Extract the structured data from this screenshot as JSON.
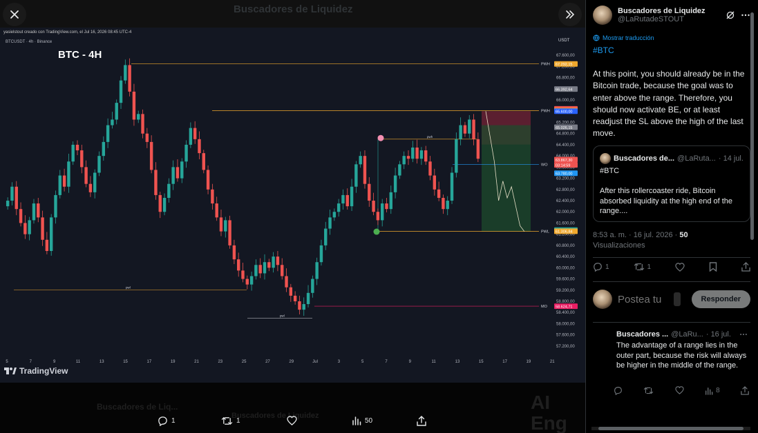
{
  "viewer": {
    "close_icon": "close-icon",
    "expand_icon": "chevrons-right-icon",
    "bg_title": "Buscadores de Liquidez",
    "tv_header": "yasielstout creado con TradingView.com, el Jul 16, 2026 08:45 UTC-4",
    "tv_brand": "TradingView",
    "actions": {
      "replies": "1",
      "retweets": "1",
      "views": "50"
    },
    "bg_bottom_name": "Buscadores de Liq...",
    "bg_bottom_name2": "Buscadores de Liquidez",
    "bg_promo": "AI Eng Tutor"
  },
  "chart_data": {
    "type": "candlestick",
    "symbol": "BTCUSDT · 4h · Binance",
    "title": "BTC - 4H",
    "currency": "USDT",
    "x_tick_labels": [
      "5",
      "7",
      "9",
      "11",
      "13",
      "15",
      "17",
      "19",
      "21",
      "23",
      "25",
      "27",
      "29",
      "Jul",
      "3",
      "5",
      "7",
      "9",
      "11",
      "13",
      "15",
      "17",
      "19",
      "21"
    ],
    "y_ticks": [
      67600,
      67200,
      66800,
      66400,
      66000,
      65600,
      65200,
      64800,
      64400,
      64000,
      63600,
      63200,
      62800,
      62400,
      62000,
      61600,
      61200,
      60800,
      60400,
      60000,
      59600,
      59200,
      58800,
      58400,
      58000,
      57600,
      57200
    ],
    "y_tick_labels": [
      "67.600,00",
      "67.200,00",
      "66.800,00",
      "66.400,00",
      "66.000,00",
      "65.600,00",
      "65.200,00",
      "64.800,00",
      "64.400,00",
      "64.000,00",
      "63.600,00",
      "63.200,00",
      "62.800,00",
      "62.400,00",
      "62.000,00",
      "61.600,00",
      "61.200,00",
      "60.800,00",
      "60.400,00",
      "60.000,00",
      "59.600,00",
      "59.200,00",
      "58.800,00",
      "58.400,00",
      "58.000,00",
      "57.600,00",
      "57.200,00"
    ],
    "ylim": [
      56900,
      68000
    ],
    "price_tags": [
      {
        "value": 67292.15,
        "label": "67.292,15",
        "color": "#f0a82d"
      },
      {
        "value": 66392.64,
        "label": "66.392,64",
        "color": "#787b86"
      },
      {
        "value": 65684.32,
        "label": "65.684,32",
        "color": "#ef5350"
      },
      {
        "value": 65622.83,
        "label": "65.622,83",
        "color": "#f0a82d"
      },
      {
        "value": 65600.0,
        "label": "65.600,00",
        "color": "#2962ff"
      },
      {
        "value": 65026.15,
        "label": "65.026,15",
        "color": "#787b86"
      },
      {
        "value": 63867.3,
        "label": "63.867,30",
        "color": "#ef5350"
      },
      {
        "value": 63680,
        "label": "03:14:59",
        "color": "#ef5350"
      },
      {
        "value": 63380,
        "label": "63.780,00",
        "color": "#2196f3"
      },
      {
        "value": 61345.74,
        "label": "61.345,74",
        "color": "#26a69a"
      },
      {
        "value": 61306.84,
        "label": "61.306,84",
        "color": "#f0a82d"
      },
      {
        "value": 58624.71,
        "label": "58.624,71",
        "color": "#e91e63"
      }
    ],
    "levels": [
      {
        "label": "PWH",
        "value": 67292
      },
      {
        "label": "PWH",
        "value": 65620
      },
      {
        "label": "WO",
        "value": 63700
      },
      {
        "label": "PWL",
        "value": 61300
      },
      {
        "label": "MO",
        "value": 58625
      }
    ],
    "inner_level_labels": [
      "pwh",
      "pwl",
      "pwl"
    ],
    "close_series": [
      62400,
      62900,
      62100,
      61600,
      61200,
      61700,
      62300,
      61800,
      61000,
      60600,
      61800,
      62600,
      63300,
      62900,
      63800,
      64400,
      64200,
      63600,
      63000,
      62700,
      63400,
      64000,
      64500,
      65100,
      65300,
      65900,
      66700,
      67250,
      66300,
      65300,
      65500,
      64800,
      64500,
      63500,
      62600,
      62000,
      62500,
      63000,
      63600,
      63200,
      63800,
      64400,
      65000,
      64600,
      64100,
      63500,
      62800,
      62300,
      61800,
      61300,
      61700,
      60800,
      60300,
      59900,
      59600,
      59400,
      59700,
      60100,
      59800,
      60200,
      60000,
      60400,
      60100,
      59700,
      59300,
      59000,
      58800,
      58500,
      58700,
      59100,
      59600,
      60200,
      60800,
      61400,
      61800,
      62000,
      62300,
      62600,
      62200,
      62900,
      63700,
      64000,
      63000,
      62400,
      62000,
      61700,
      62300,
      62100,
      62700,
      63300,
      63700,
      64000,
      63900,
      64300,
      63900,
      64200,
      63800,
      63300,
      62800,
      62500,
      62100,
      62400,
      63400,
      64600,
      65100,
      64800,
      65300,
      64600,
      63900
    ],
    "projection_path": [
      65600,
      64700,
      63800,
      62400,
      63100,
      62500,
      62900,
      62200,
      61500,
      61300
    ],
    "annotations": [
      "PWH",
      "WO",
      "PWL",
      "MO"
    ]
  },
  "tweet": {
    "author": "Buscadores de Liquidez",
    "handle": "@LaRutadeSTOUT",
    "translate_label": "Mostrar traducción",
    "hashtag": "#BTC",
    "body": "At this point, you should already be in the Bitcoin trade, because the goal was to enter above the range. Therefore, you should now activate BE, or at least readjust the SL above the high of the last move.",
    "quote": {
      "author": "Buscadores de...",
      "handle": "@LaRuta...",
      "date": "· 14 jul.",
      "hashtag": "#BTC",
      "body": "After this rollercoaster ride, Bitcoin absorbed liquidity at the high end of the range...."
    },
    "timestamp": "8:53 a. m. · 16 jul. 2026 ·",
    "views_count": "50",
    "views_label": "Visualizaciones",
    "actions": {
      "replies": "1",
      "retweets": "1"
    },
    "reply_placeholder": "Postea tu",
    "reply_button": "Responder"
  },
  "reply": {
    "author": "Buscadores ...",
    "handle": "@LaRu...",
    "date": "· 16 jul.",
    "body": "The advantage of a range lies in the outer part, because the risk will always be higher in the middle of the range.",
    "views": "8"
  },
  "colors": {
    "up": "#26a69a",
    "down": "#ef5350",
    "accent": "#1d9bf0",
    "level": "#f0a82d"
  }
}
